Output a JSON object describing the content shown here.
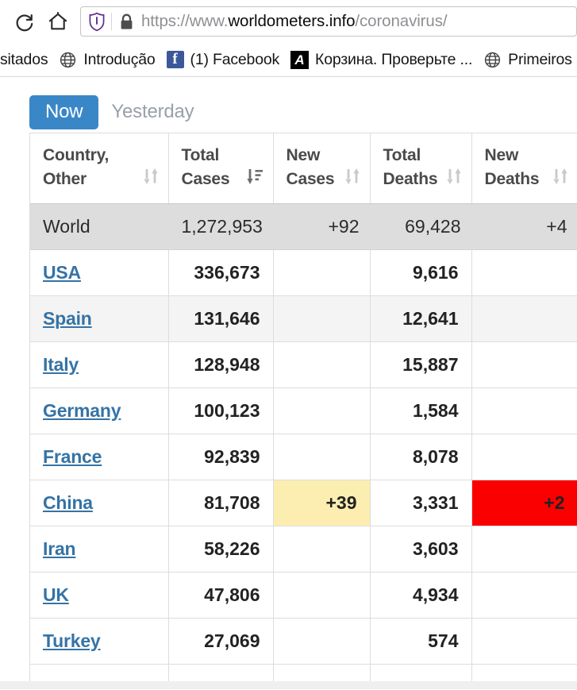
{
  "browser": {
    "reload_icon": "reload-icon",
    "home_icon": "home-icon",
    "shield_icon": "shield-icon",
    "lock_icon": "lock-icon",
    "url_prefix": "https://www.",
    "url_host": "worldometers.info",
    "url_path": "/coronavirus/",
    "url_full": "https://www.worldometers.info/coronavirus/",
    "bookmarks": [
      {
        "label": "sitados",
        "icon": "none"
      },
      {
        "label": "Introdução",
        "icon": "globe-icon"
      },
      {
        "label": "(1) Facebook",
        "icon": "facebook-icon"
      },
      {
        "label": "Корзина. Проверьте ...",
        "icon": "alfa-icon"
      },
      {
        "label": "Primeiros pa",
        "icon": "globe-icon"
      }
    ]
  },
  "tabs": {
    "active": "Now",
    "inactive": "Yesterday"
  },
  "table": {
    "columns": [
      {
        "label": "Country,\nOther",
        "line1": "Country,",
        "line2": "Other",
        "sort": "none",
        "sort_icon": "sort-both-icon",
        "align": "left"
      },
      {
        "label": "Total Cases",
        "line1": "Total",
        "line2": "Cases",
        "sort": "desc",
        "sort_icon": "sort-desc-icon",
        "align": "right"
      },
      {
        "label": "New Cases",
        "line1": "New",
        "line2": "Cases",
        "sort": "none",
        "sort_icon": "sort-both-icon",
        "align": "right"
      },
      {
        "label": "Total Deaths",
        "line1": "Total",
        "line2": "Deaths",
        "sort": "none",
        "sort_icon": "sort-both-icon",
        "align": "right"
      },
      {
        "label": "New Deaths",
        "line1": "New",
        "line2": "Deaths",
        "sort": "none",
        "sort_icon": "sort-both-icon",
        "align": "right"
      }
    ],
    "rows": [
      {
        "country": "World",
        "is_link": false,
        "highlight_row": "world",
        "total_cases": "1,272,953",
        "new_cases": "+92",
        "total_deaths": "69,428",
        "new_deaths": "+4",
        "new_cases_hl": "none",
        "new_deaths_hl": "none"
      },
      {
        "country": "USA",
        "is_link": true,
        "highlight_row": "none",
        "total_cases": "336,673",
        "new_cases": "",
        "total_deaths": "9,616",
        "new_deaths": "",
        "new_cases_hl": "none",
        "new_deaths_hl": "none"
      },
      {
        "country": "Spain",
        "is_link": true,
        "highlight_row": "alt",
        "total_cases": "131,646",
        "new_cases": "",
        "total_deaths": "12,641",
        "new_deaths": "",
        "new_cases_hl": "none",
        "new_deaths_hl": "none"
      },
      {
        "country": "Italy",
        "is_link": true,
        "highlight_row": "none",
        "total_cases": "128,948",
        "new_cases": "",
        "total_deaths": "15,887",
        "new_deaths": "",
        "new_cases_hl": "none",
        "new_deaths_hl": "none"
      },
      {
        "country": "Germany",
        "is_link": true,
        "highlight_row": "none",
        "total_cases": "100,123",
        "new_cases": "",
        "total_deaths": "1,584",
        "new_deaths": "",
        "new_cases_hl": "none",
        "new_deaths_hl": "none"
      },
      {
        "country": "France",
        "is_link": true,
        "highlight_row": "none",
        "total_cases": "92,839",
        "new_cases": "",
        "total_deaths": "8,078",
        "new_deaths": "",
        "new_cases_hl": "none",
        "new_deaths_hl": "none"
      },
      {
        "country": "China",
        "is_link": true,
        "highlight_row": "none",
        "total_cases": "81,708",
        "new_cases": "+39",
        "total_deaths": "3,331",
        "new_deaths": "+2",
        "new_cases_hl": "yellow",
        "new_deaths_hl": "red"
      },
      {
        "country": "Iran",
        "is_link": true,
        "highlight_row": "none",
        "total_cases": "58,226",
        "new_cases": "",
        "total_deaths": "3,603",
        "new_deaths": "",
        "new_cases_hl": "none",
        "new_deaths_hl": "none"
      },
      {
        "country": "UK",
        "is_link": true,
        "highlight_row": "none",
        "total_cases": "47,806",
        "new_cases": "",
        "total_deaths": "4,934",
        "new_deaths": "",
        "new_cases_hl": "none",
        "new_deaths_hl": "none"
      },
      {
        "country": "Turkey",
        "is_link": true,
        "highlight_row": "none",
        "total_cases": "27,069",
        "new_cases": "",
        "total_deaths": "574",
        "new_deaths": "",
        "new_cases_hl": "none",
        "new_deaths_hl": "none"
      }
    ]
  },
  "colors": {
    "tab_active_bg": "#3a87c8",
    "tab_inactive_text": "#9aa0a6",
    "link": "#3573a5",
    "world_row_bg": "#dddddd",
    "alt_row_bg": "#f4f4f4",
    "new_cases_highlight": "#fbeeb0",
    "new_deaths_highlight": "#fa0000",
    "shield_icon": "#5b2d8e",
    "facebook_blue": "#3b5998"
  }
}
